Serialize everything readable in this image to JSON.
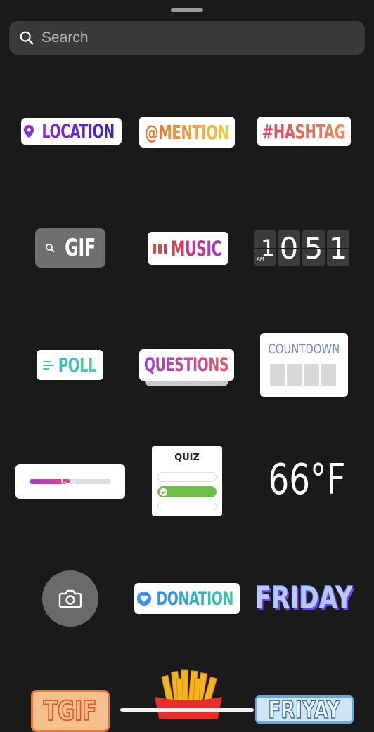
{
  "search": {
    "placeholder": "Search",
    "icon": "search-icon"
  },
  "stickers": {
    "location": "LOCATION",
    "mention": "@MENTION",
    "hashtag": "#HASHTAG",
    "gif": "GIF",
    "music": "MUSIC",
    "clock": {
      "ampm": "AM",
      "digits": [
        "10",
        "5",
        "1"
      ]
    },
    "poll": "POLL",
    "questions": "QUESTIONS",
    "countdown": "COUNTDOWN",
    "slider": {
      "emoji": "😍",
      "level": 0.5
    },
    "quiz": "QUIZ",
    "temperature": "66°F",
    "donation": "DONATION",
    "friday": "FRIDAY",
    "tgif": "TGIF",
    "frivay": "FRIYAY"
  },
  "colors": {
    "background": "#1a1a1a",
    "search_bg": "#3a3a3a",
    "quiz_correct": "#6fbf4a"
  }
}
